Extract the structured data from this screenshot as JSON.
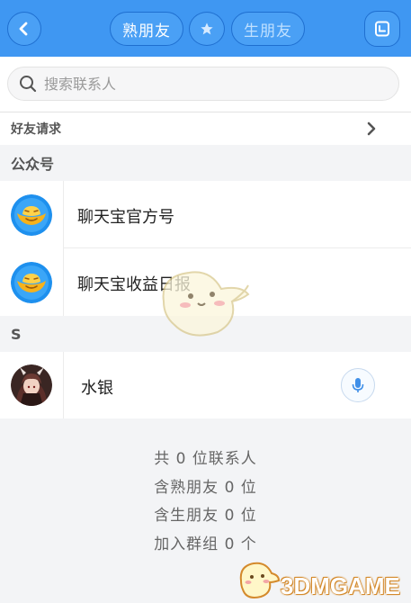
{
  "header": {
    "tab_familiar": "熟朋友",
    "tab_stranger": "生朋友",
    "back_icon": "chevron-left-icon",
    "star_icon": "star-icon",
    "contact_icon": "contact-book-icon"
  },
  "search": {
    "placeholder": "搜索联系人",
    "value": ""
  },
  "friend_requests": {
    "label": "好友请求"
  },
  "sections": [
    {
      "title": "公众号",
      "items": [
        {
          "name": "聊天宝官方号",
          "avatar": "gold-ingot-icon"
        },
        {
          "name": "聊天宝收益日报",
          "avatar": "gold-ingot-icon"
        }
      ]
    },
    {
      "title": "S",
      "items": [
        {
          "name": "水银",
          "avatar": "user-avatar",
          "action_icon": "microphone-icon"
        }
      ]
    }
  ],
  "stats": {
    "total": "共 0 位联系人",
    "familiar": "含熟朋友 0 位",
    "stranger": "含生朋友 0 位",
    "groups": "加入群组 0 个"
  },
  "watermark": {
    "text": "3DMGAME"
  },
  "colors": {
    "header_bg": "#3f97f2",
    "accent": "#3f97f2",
    "page_bg": "#f3f4f6"
  }
}
